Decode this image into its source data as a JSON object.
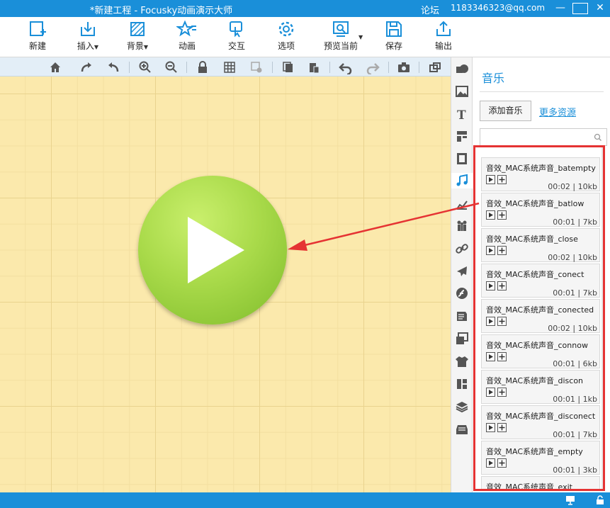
{
  "titlebar": {
    "title": "*新建工程 - Focusky动画演示大师",
    "forum": "论坛",
    "email": "1183346323@qq.com",
    "minimize": "—",
    "close": "✕"
  },
  "toolbar": {
    "items": [
      {
        "label": "新建",
        "icon": "new-file-icon"
      },
      {
        "label": "插入",
        "icon": "insert-icon",
        "dropdown": true
      },
      {
        "label": "背景",
        "icon": "background-icon",
        "dropdown": true
      },
      {
        "label": "动画",
        "icon": "animation-icon"
      },
      {
        "label": "交互",
        "icon": "interaction-icon"
      },
      {
        "label": "选项",
        "icon": "gear-icon"
      },
      {
        "label": "预览当前",
        "icon": "preview-icon",
        "dropdown": true
      },
      {
        "label": "保存",
        "icon": "save-icon"
      },
      {
        "label": "输出",
        "icon": "export-icon"
      }
    ]
  },
  "panel": {
    "title": "音乐",
    "add_music": "添加音乐",
    "more_resources": "更多资源",
    "search_placeholder": "",
    "items": [
      {
        "name": "音效_MAC系统声音_batempty",
        "duration": "00:02",
        "size": "10kb"
      },
      {
        "name": "音效_MAC系统声音_batlow",
        "duration": "00:01",
        "size": "7kb"
      },
      {
        "name": "音效_MAC系统声音_close",
        "duration": "00:02",
        "size": "10kb"
      },
      {
        "name": "音效_MAC系统声音_conect",
        "duration": "00:01",
        "size": "7kb"
      },
      {
        "name": "音效_MAC系统声音_conected",
        "duration": "00:02",
        "size": "10kb"
      },
      {
        "name": "音效_MAC系统声音_connow",
        "duration": "00:01",
        "size": "6kb"
      },
      {
        "name": "音效_MAC系统声音_discon",
        "duration": "00:01",
        "size": "1kb"
      },
      {
        "name": "音效_MAC系统声音_disconect",
        "duration": "00:01",
        "size": "7kb"
      },
      {
        "name": "音效_MAC系统声音_empty",
        "duration": "00:01",
        "size": "3kb"
      },
      {
        "name": "音效_MAC系统声音_exit",
        "duration": "",
        "size": ""
      }
    ]
  },
  "colors": {
    "titlebar": "#1a8fd9",
    "canvas": "#fbe9ac",
    "highlight": "#e53333",
    "play_button": "#a9da4a"
  }
}
